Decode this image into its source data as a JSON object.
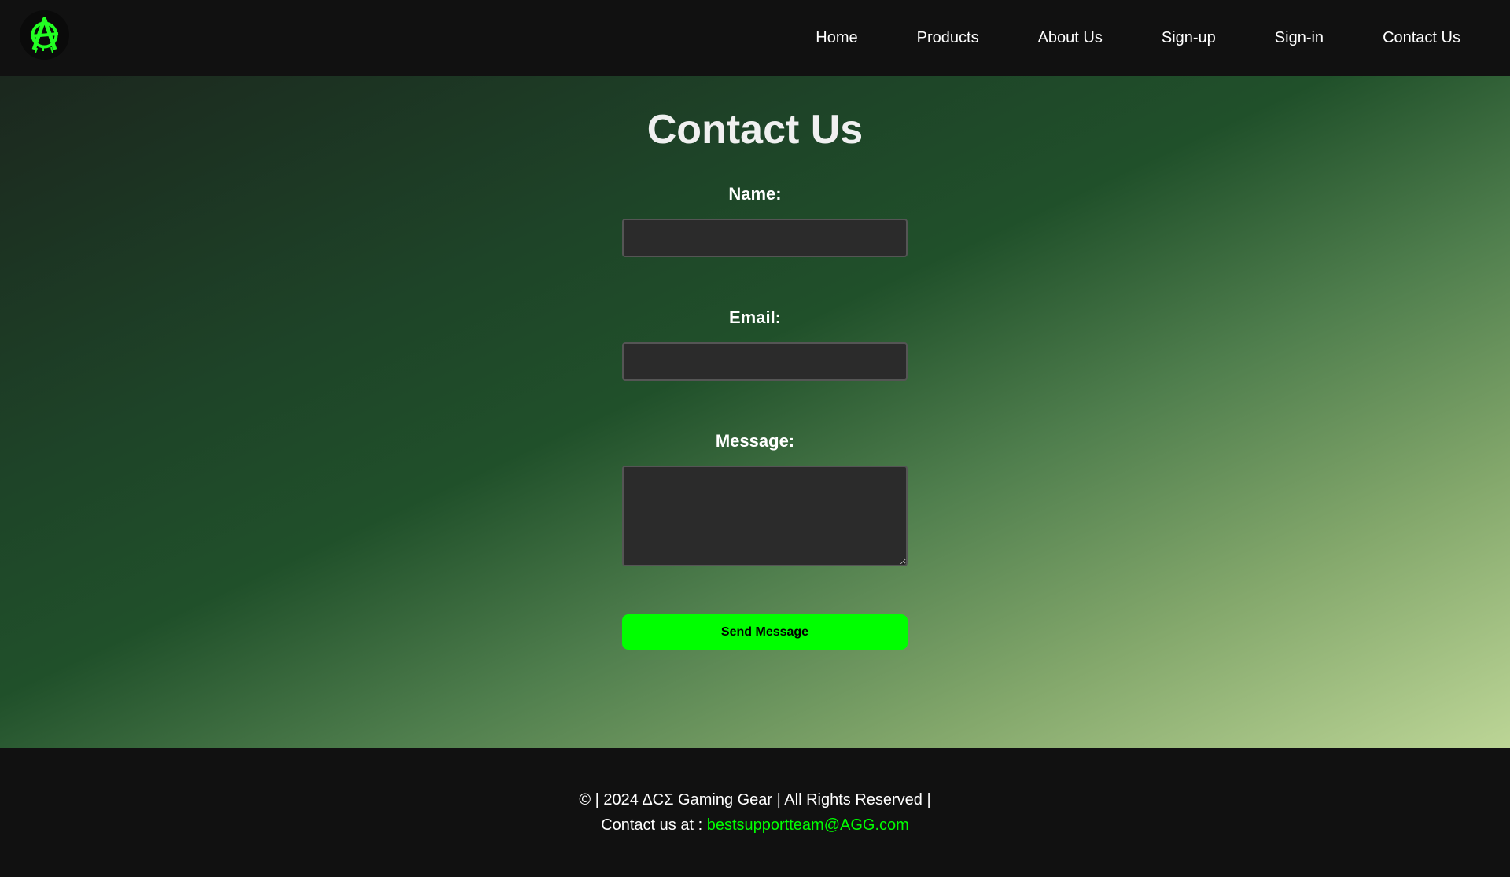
{
  "navbar": {
    "logo_icon": "anarchy-logo-icon",
    "links": [
      {
        "label": "Home"
      },
      {
        "label": "Products"
      },
      {
        "label": "About Us"
      },
      {
        "label": "Sign-up"
      },
      {
        "label": "Sign-in"
      },
      {
        "label": "Contact Us"
      }
    ]
  },
  "main": {
    "title": "Contact Us",
    "form": {
      "name_label": "Name:",
      "name_value": "",
      "email_label": "Email:",
      "email_value": "",
      "message_label": "Message:",
      "message_value": "",
      "submit_label": "Send Message"
    }
  },
  "footer": {
    "copyright": "© | 2024 ΔCΣ Gaming Gear | All Rights Reserved |",
    "contact_prefix": "Contact us at :",
    "contact_email": "bestsupportteam@AGG.com"
  },
  "colors": {
    "accent": "#00ff00",
    "nav_bg": "#111111",
    "field_bg": "#2b2b2b"
  }
}
